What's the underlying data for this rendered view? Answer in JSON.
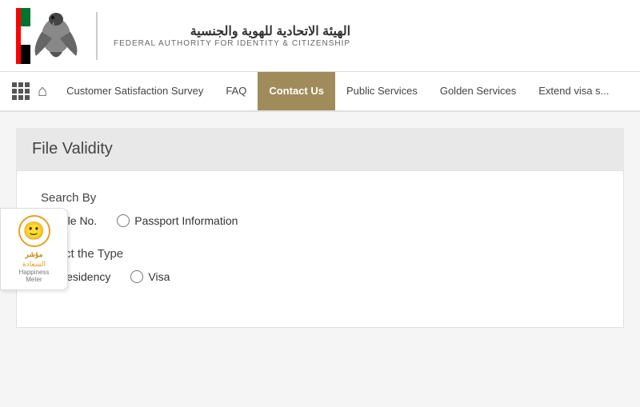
{
  "header": {
    "logo_arabic": "الهيئة الاتحادية للهوية والجنسية",
    "logo_english": "FEDERAL AUTHORITY FOR IDENTITY & CITIZENSHIP"
  },
  "nav": {
    "items": [
      {
        "label": "Customer Satisfaction Survey",
        "active": false
      },
      {
        "label": "FAQ",
        "active": false
      },
      {
        "label": "Contact Us",
        "active": true
      },
      {
        "label": "Public Services",
        "active": false
      },
      {
        "label": "Golden Services",
        "active": false
      },
      {
        "label": "Extend visa s...",
        "active": false
      }
    ]
  },
  "file_validity": {
    "title": "File Validity",
    "search_by_label": "Search By",
    "search_options": [
      {
        "label": "File No.",
        "checked": true
      },
      {
        "label": "Passport Information",
        "checked": false
      }
    ],
    "select_type_label": "Select the Type",
    "type_options": [
      {
        "label": "Residency",
        "checked": true
      },
      {
        "label": "Visa",
        "checked": false
      }
    ]
  },
  "happiness_meter": {
    "arabic_line1": "مؤشر",
    "arabic_line2": "السعادة",
    "english": "Happiness",
    "meter": "Meter"
  }
}
